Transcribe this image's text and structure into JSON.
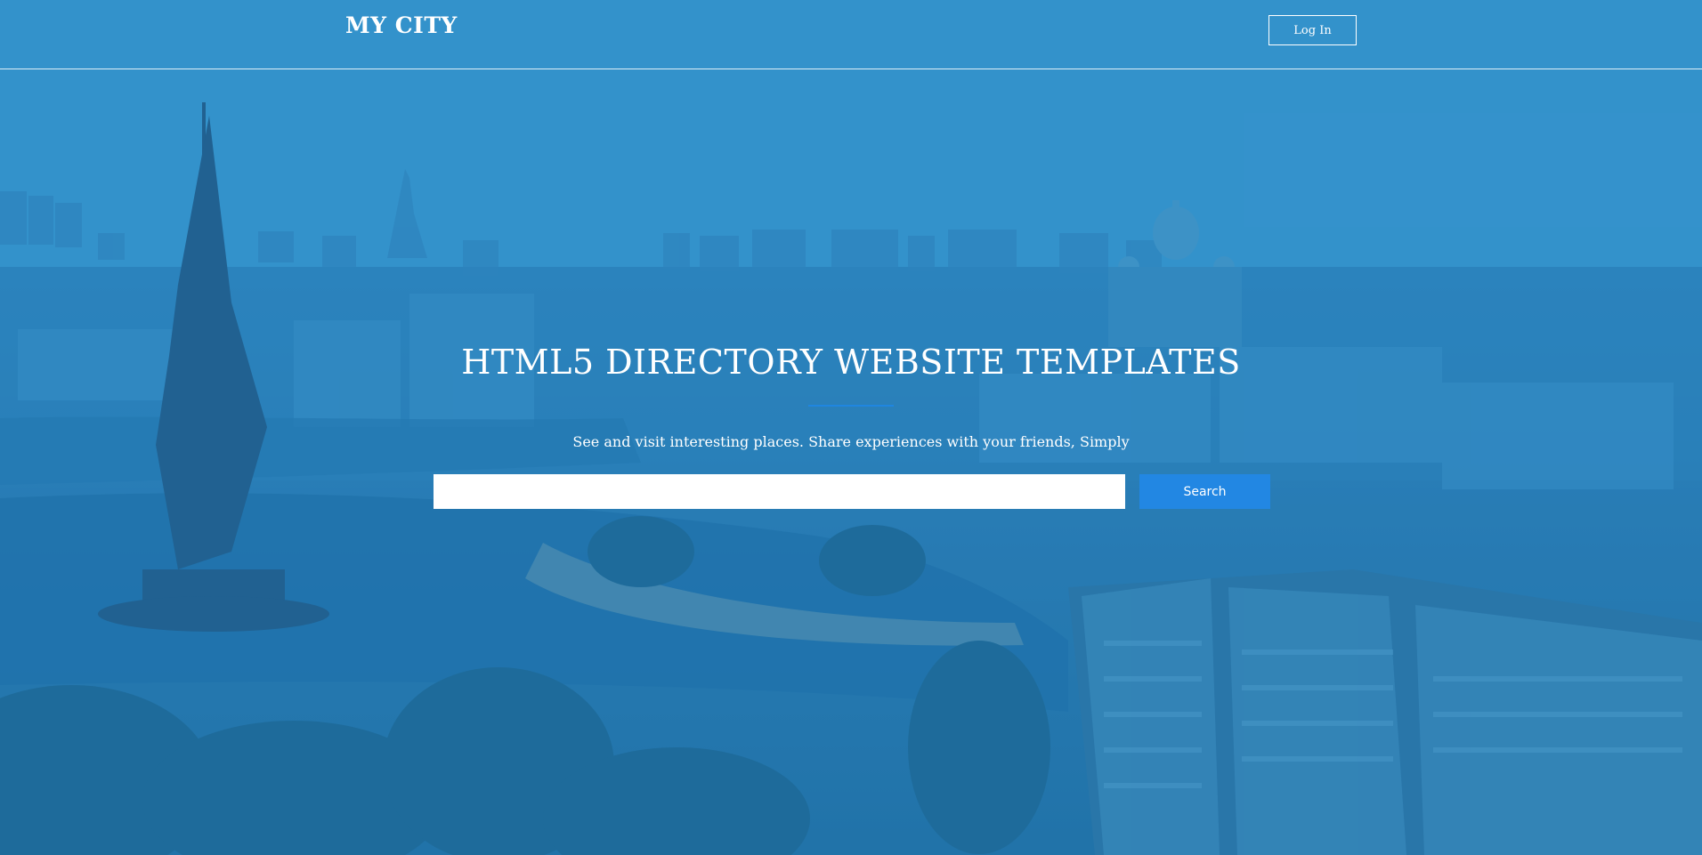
{
  "header": {
    "logo": "MY CITY",
    "login_label": "Log In"
  },
  "hero": {
    "title": "HTML5 DIRECTORY WEBSITE TEMPLATES",
    "subtitle": "See and visit interesting places. Share experiences with your friends, Simply",
    "search_placeholder": "",
    "search_value": "",
    "search_button": "Search"
  },
  "colors": {
    "overlay": "#2f86bd",
    "accent": "#2287e3",
    "text": "#ffffff"
  },
  "icons": {
    "background": "city-skyline-image"
  }
}
